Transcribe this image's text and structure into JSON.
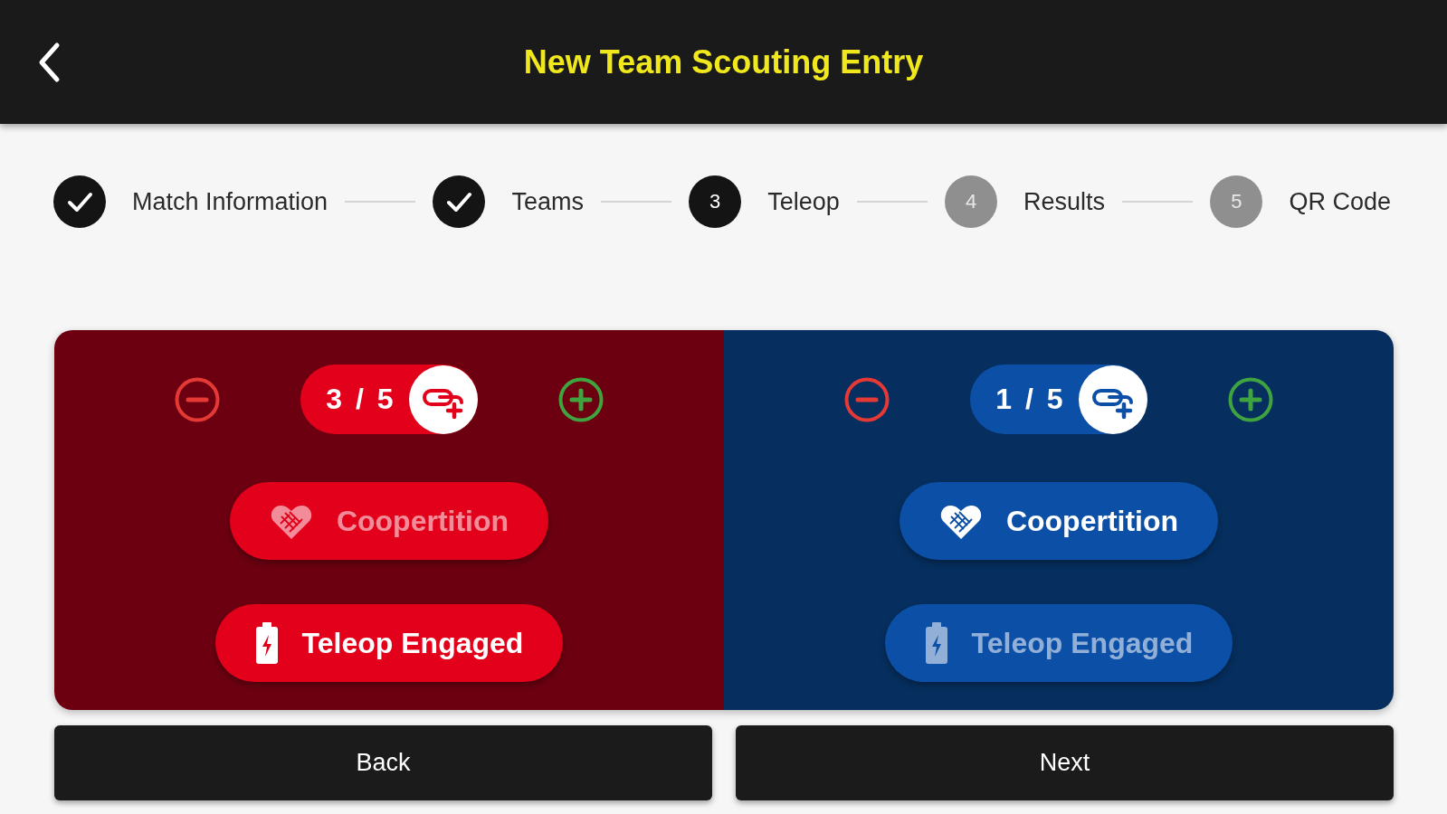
{
  "header": {
    "title": "New Team Scouting Entry"
  },
  "steps": [
    {
      "label": "Match Information",
      "completed": true,
      "selected": false
    },
    {
      "label": "Teams",
      "completed": true,
      "selected": false
    },
    {
      "label": "Teleop",
      "number": "3",
      "completed": false,
      "selected": true
    },
    {
      "label": "Results",
      "number": "4",
      "completed": false,
      "selected": false
    },
    {
      "label": "QR Code",
      "number": "5",
      "completed": false,
      "selected": false
    }
  ],
  "alliances": [
    {
      "color": "#6c0011",
      "counter": {
        "value": "3 / 5",
        "color": "#e2001a"
      },
      "toggles": [
        {
          "kind": "coopertition",
          "label": "Coopertition",
          "on": false
        },
        {
          "kind": "engaged",
          "label": "Teleop Engaged",
          "on": true
        }
      ]
    },
    {
      "color": "#062f5f",
      "counter": {
        "value": "1 / 5",
        "color": "#0c4fa6"
      },
      "toggles": [
        {
          "kind": "coopertition",
          "label": "Coopertition",
          "on": true
        },
        {
          "kind": "engaged",
          "label": "Teleop Engaged",
          "on": false
        }
      ]
    }
  ],
  "footer": {
    "buttons": [
      "Back",
      "Next"
    ]
  }
}
